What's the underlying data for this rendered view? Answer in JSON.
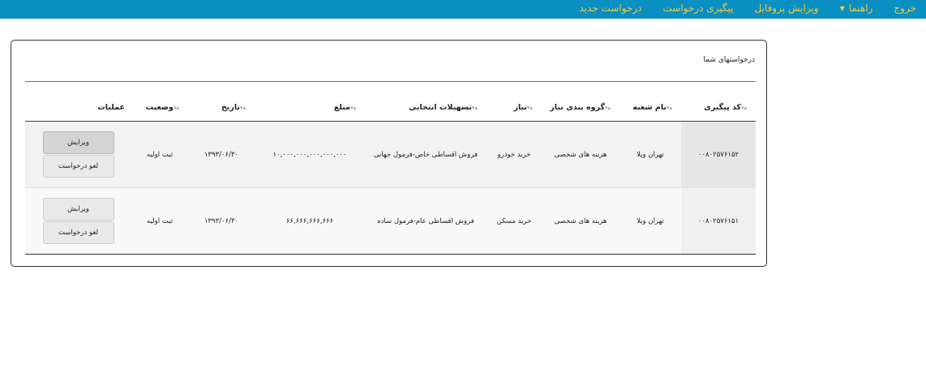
{
  "nav": {
    "items": [
      {
        "label": "درخواست جدید"
      },
      {
        "label": "پیگیری درخواست"
      },
      {
        "label": "ویرایش پروفایل"
      },
      {
        "label": "راهنما"
      },
      {
        "label": "خروج"
      }
    ]
  },
  "panel": {
    "caption": "درخواستهای شما"
  },
  "table": {
    "headers": {
      "code": "کد پیگیری",
      "branch": "نام شعبه",
      "group": "گروه بندی نیاز",
      "need": "نیاز",
      "facility": "تسهیلات انتخابی",
      "amount": "مبلغ",
      "date": "تاریخ",
      "status": "وضعیت",
      "actions": "عملیات"
    },
    "rows": [
      {
        "code": "۰۰۸۰۲۵۷۶۱۵۲",
        "branch": "تهران ویلا",
        "group": "هزینه های شخصی",
        "need": "خرید خودرو",
        "facility": "فروش اقساطی خاص-فرمول جهانی",
        "amount": "۱۰,۰۰۰,۰۰۰,۰۰۰,۰۰۰,۰۰۰",
        "date": "۱۳۹۳/۰۶/۳۰",
        "status": "ثبت اولیه",
        "edit_label": "ویرایش",
        "cancel_label": "لغو درخواست"
      },
      {
        "code": "۰۰۸۰۲۵۷۶۱۵۱",
        "branch": "تهران ویلا",
        "group": "هزینه های شخصی",
        "need": "خرید مسکن",
        "facility": "فروش اقساطی عام-فرمول ساده",
        "amount": "۶۶,۶۶۶,۶۶۶,۶۶۶",
        "date": "۱۳۹۳/۰۶/۳۰",
        "status": "ثبت اولیه",
        "edit_label": "ویرایش",
        "cancel_label": "لغو درخواست"
      }
    ]
  },
  "colors": {
    "nav_bg": "#0a8fc2",
    "nav_text": "#f3c93e"
  },
  "icons": {
    "sort": "sort-arrows-icon",
    "dropdown": "caret-down-icon"
  }
}
